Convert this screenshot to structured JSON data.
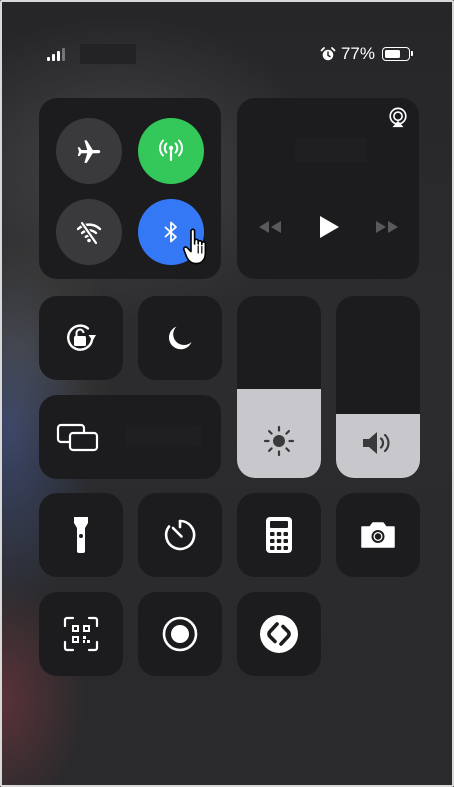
{
  "status_bar": {
    "battery_percent": "77%",
    "battery_level": 0.77,
    "signal_bars": 3,
    "icons": [
      "signal-icon",
      "alarm-icon",
      "battery-icon"
    ]
  },
  "connectivity": {
    "airplane_mode": {
      "icon": "airplane-icon",
      "on": false
    },
    "cellular_data": {
      "icon": "antenna-icon",
      "on": true,
      "color": "#34c759"
    },
    "wifi": {
      "icon": "wifi-off-icon",
      "on": false
    },
    "bluetooth": {
      "icon": "bluetooth-icon",
      "on": true,
      "color": "#3478f6"
    }
  },
  "media": {
    "icons": [
      "airplay-icon",
      "rewind-icon",
      "play-icon",
      "fast-forward-icon"
    ]
  },
  "controls": {
    "orientation_lock": "rotation-lock-icon",
    "do_not_disturb": "moon-icon",
    "screen_mirroring": "screen-mirroring-icon",
    "brightness_level": 0.49,
    "volume_level": 0.35,
    "flashlight": "flashlight-icon",
    "timer": "timer-icon",
    "calculator": "calculator-icon",
    "camera": "camera-icon",
    "qr_scanner": "qr-code-icon",
    "screen_recording": "record-icon",
    "shazam": "shazam-icon"
  },
  "colors": {
    "green": "#34c759",
    "blue": "#3478f6",
    "tile": "#1c1c1e"
  }
}
